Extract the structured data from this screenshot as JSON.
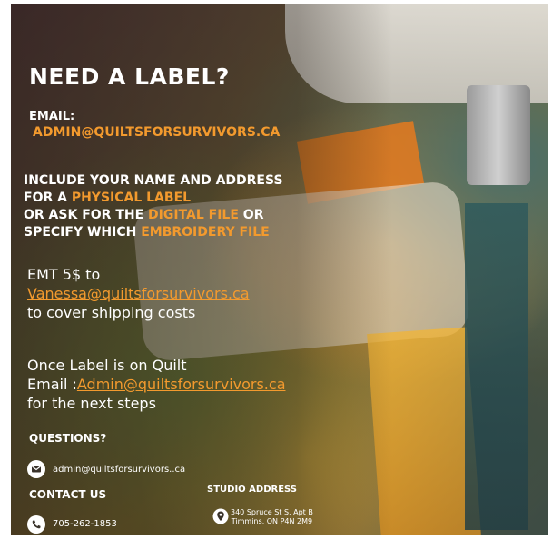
{
  "title": "NEED A LABEL?",
  "email_section": {
    "label": "EMAIL:",
    "value": "ADMIN@QUILTSFORSURVIVORS.CA"
  },
  "instructions": {
    "line1": "INCLUDE YOUR NAME AND ADDRESS",
    "line2_prefix": "FOR A ",
    "line2_highlight": "PHYSICAL LABEL",
    "line3_prefix": "OR ASK FOR THE ",
    "line3_highlight": "DIGITAL FILE",
    "line3_suffix": " OR",
    "line4_prefix": "SPECIFY WHICH ",
    "line4_highlight": "EMBROIDERY FILE"
  },
  "payment": {
    "line1": "EMT 5$ to",
    "email": "Vanessa@quiltsforsurvivors.ca",
    "line3": "to cover shipping costs"
  },
  "next_steps": {
    "line1": "Once Label is on Quilt",
    "email_prefix": "Email :",
    "email": "Admin@quiltsforsurvivors.ca",
    "line3": "for the next steps"
  },
  "questions": {
    "heading": "QUESTIONS?",
    "email": "admin@quiltsforsurvivors..ca"
  },
  "contact": {
    "heading": "CONTACT US",
    "phone": "705-262-1853"
  },
  "studio": {
    "heading": "STUDIO ADDRESS",
    "address_line1": "340 Spruce St S, Apt B",
    "address_line2": "Timmins, ON P4N 2M9"
  },
  "colors": {
    "accent": "#f39a2e",
    "text": "#ffffff"
  }
}
